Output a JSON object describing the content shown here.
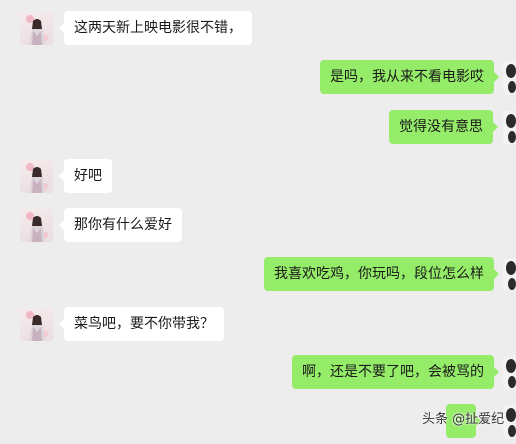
{
  "messages": [
    {
      "side": "left",
      "text": "这两天新上映电影很不错，"
    },
    {
      "side": "right",
      "text": "是吗，我从来不看电影哎"
    },
    {
      "side": "right",
      "text": "觉得没有意思"
    },
    {
      "side": "left",
      "text": "好吧"
    },
    {
      "side": "left",
      "text": "那你有什么爱好"
    },
    {
      "side": "right",
      "text": "我喜欢吃鸡，你玩吗，段位怎么样"
    },
    {
      "side": "left",
      "text": "菜鸟吧，要不你带我？"
    },
    {
      "side": "right",
      "text": "啊，还是不要了吧，会被骂的"
    },
    {
      "side": "right",
      "text": ""
    }
  ],
  "watermark": "头条 @扯爱纪",
  "colors": {
    "background": "#ededed",
    "incoming_bubble": "#ffffff",
    "outgoing_bubble": "#95ec69"
  },
  "avatars": {
    "left": "girl-avatar",
    "right": "cat-avatar"
  }
}
